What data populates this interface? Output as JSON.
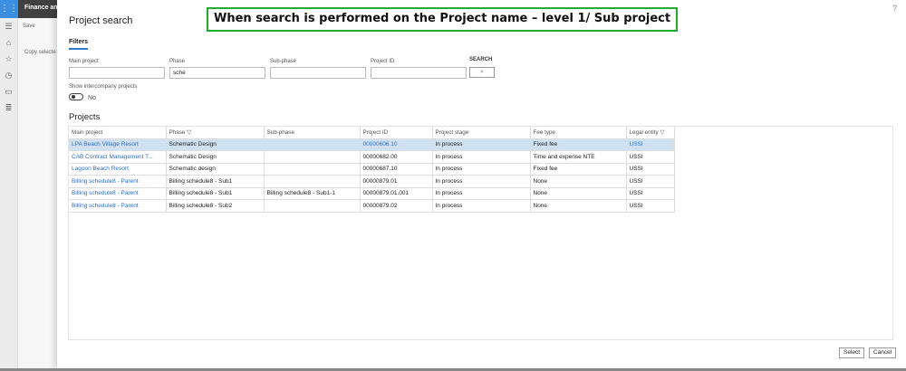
{
  "background": {
    "app_name": "Finance an",
    "save_label": "Save",
    "copy_text": "Copy selecte",
    "nav_icons": [
      "menu-icon",
      "home-icon",
      "star-icon",
      "clock-icon",
      "workspace-icon",
      "list-icon"
    ]
  },
  "dialog": {
    "title": "Project search",
    "help": "?",
    "filters_tab": "Filters",
    "filters": {
      "main_project": {
        "label": "Main project",
        "value": ""
      },
      "phase": {
        "label": "Phase",
        "value": "sche"
      },
      "sub_phase": {
        "label": "Sub-phase",
        "value": ""
      },
      "project_id": {
        "label": "Project ID",
        "value": ""
      },
      "search_label": "SEARCH",
      "show_intercompany_label": "Show intercompany projects",
      "show_intercompany_value": "No"
    },
    "projects_heading": "Projects",
    "columns": [
      "Main project",
      "Phase",
      "Sub-phase",
      "Project ID",
      "Project stage",
      "Fee type",
      "Legal entity"
    ],
    "rows": [
      [
        "LPA Beach Village Resort",
        "Schematic Design",
        "",
        "00000606.10",
        "In process",
        "Fixed fee",
        "USSI"
      ],
      [
        "CAB Contract Management T...",
        "Schematic Design",
        "",
        "00000682.00",
        "In process",
        "Time and expense NTE",
        "USSI"
      ],
      [
        "Lagoon Beach Resort",
        "Schematic design",
        "",
        "00000687.10",
        "In process",
        "Fixed fee",
        "USSI"
      ],
      [
        "Billing schedule8 - Parent",
        "Billing schedule8 - Sub1",
        "",
        "00000879.01",
        "In process",
        "None",
        "USSI"
      ],
      [
        "Billing schedule8 - Parent",
        "Billing schedule8 - Sub1",
        "Billing schedule8 - Sub1-1",
        "00000879.01.001",
        "In process",
        "None",
        "USSI"
      ],
      [
        "Billing schedule8 - Parent",
        "Billing schedule8 - Sub2",
        "",
        "00000879.02",
        "In process",
        "None",
        "USSI"
      ]
    ],
    "select_label": "Select",
    "cancel_label": "Cancel"
  },
  "annotation": "When search is performed on the Project name – level 1/ Sub project",
  "colors": {
    "accent": "#2e7cd0",
    "selected_row": "#cfe0f1",
    "annotation_border": "#22aa33"
  }
}
